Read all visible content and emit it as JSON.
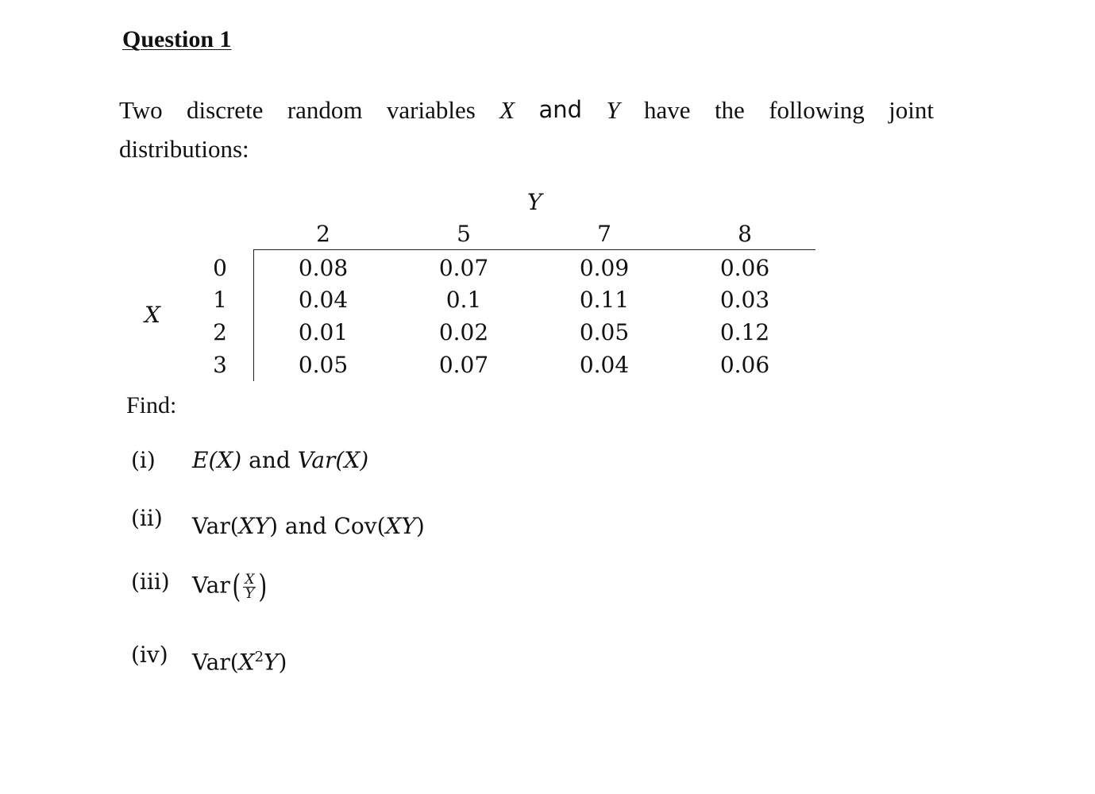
{
  "title": "Question 1",
  "intro": {
    "line1_words": [
      "Two",
      "discrete",
      "random",
      "variables"
    ],
    "var_x": "X",
    "and_word": "and",
    "var_y": "Y",
    "line1_tail_words": [
      "have",
      "the",
      "following",
      "joint"
    ],
    "line2": "distributions:"
  },
  "table": {
    "y_label": "Y",
    "x_label": "X",
    "y_values": [
      "2",
      "5",
      "7",
      "8"
    ],
    "x_values": [
      "0",
      "1",
      "2",
      "3"
    ],
    "probabilities": [
      [
        "0.08",
        "0.07",
        "0.09",
        "0.06"
      ],
      [
        "0.04",
        "0.1",
        "0.11",
        "0.03"
      ],
      [
        "0.01",
        "0.02",
        "0.05",
        "0.12"
      ],
      [
        "0.05",
        "0.07",
        "0.04",
        "0.06"
      ]
    ]
  },
  "find_label": "Find:",
  "questions": [
    {
      "num": "(i)",
      "parts": {
        "a": "E(X)",
        "and": " and ",
        "b": "Var(X)"
      }
    },
    {
      "num": "(ii)",
      "parts": {
        "a_prefix": "Var(",
        "a_var": "XY",
        "a_suffix": ")",
        "and": " and ",
        "b_prefix": "Cov(",
        "b_var": "XY",
        "b_suffix": ")"
      }
    },
    {
      "num": "(iii)",
      "parts": {
        "prefix": "Var",
        "numerator": "X",
        "denominator": "Y"
      }
    },
    {
      "num": "(iv)",
      "parts": {
        "prefix": "Var(",
        "base": "X",
        "exp": "2",
        "var2": "Y",
        "suffix": ")"
      }
    }
  ]
}
